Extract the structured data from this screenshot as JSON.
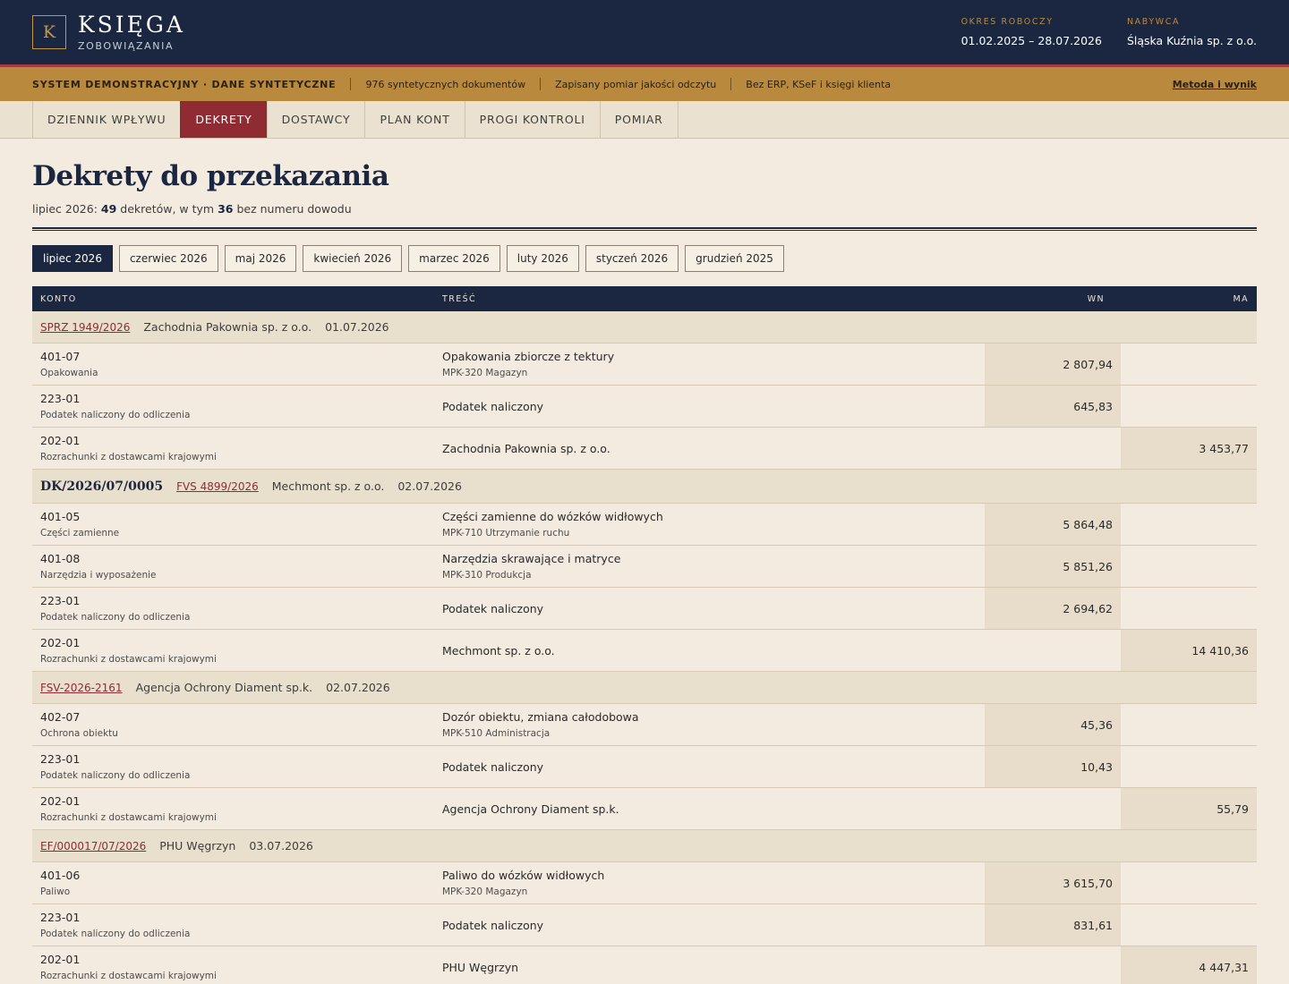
{
  "header": {
    "logo_letter": "K",
    "brand": "KSIĘGA",
    "brand_sub": "ZOBOWIĄZANIA",
    "period_label": "OKRES ROBOCZY",
    "period_value": "01.02.2025 – 28.07.2026",
    "buyer_label": "NABYWCA",
    "buyer_value": "Śląska Kuźnia sp. z o.o."
  },
  "notice": {
    "system": "SYSTEM DEMONSTRACYJNY · DANE SYNTETYCZNE",
    "docs": "976 syntetycznych dokumentów",
    "measure": "Zapisany pomiar jakości odczytu",
    "noerp": "Bez ERP, KSeF i księgi klienta",
    "link": "Metoda i wynik"
  },
  "nav": {
    "tabs": [
      "DZIENNIK WPŁYWU",
      "DEKRETY",
      "DOSTAWCY",
      "PLAN KONT",
      "PROGI KONTROLI",
      "POMIAR"
    ],
    "active": "DEKRETY"
  },
  "page": {
    "title": "Dekrety do przekazania",
    "sub_prefix": "lipiec 2026: ",
    "sub_count": "49",
    "sub_mid": " dekretów, w tym ",
    "sub_missing": "36",
    "sub_suffix": " bez numeru dowodu"
  },
  "months": [
    "lipiec 2026",
    "czerwiec 2026",
    "maj 2026",
    "kwiecień 2026",
    "marzec 2026",
    "luty 2026",
    "styczeń 2026",
    "grudzień 2025"
  ],
  "table": {
    "col_account": "KONTO",
    "col_desc": "TREŚĆ",
    "col_wn": "WN",
    "col_ma": "MA",
    "groups": [
      {
        "dk": "",
        "doc": "SPRZ 1949/2026",
        "vendor": "Zachodnia Pakownia sp. z o.o.",
        "date": "01.07.2026",
        "rows": [
          {
            "acc": "401-07",
            "acc_name": "Opakowania",
            "desc": "Opakowania zbiorcze z tektury",
            "mpk": "MPK-320 Magazyn",
            "wn": "2 807,94",
            "ma": ""
          },
          {
            "acc": "223-01",
            "acc_name": "Podatek naliczony do odliczenia",
            "desc": "Podatek naliczony",
            "mpk": "",
            "wn": "645,83",
            "ma": ""
          },
          {
            "acc": "202-01",
            "acc_name": "Rozrachunki z dostawcami krajowymi",
            "desc": "Zachodnia Pakownia sp. z o.o.",
            "mpk": "",
            "wn": "",
            "ma": "3 453,77"
          }
        ]
      },
      {
        "dk": "DK/2026/07/0005",
        "doc": "FVS 4899/2026",
        "vendor": "Mechmont sp. z o.o.",
        "date": "02.07.2026",
        "rows": [
          {
            "acc": "401-05",
            "acc_name": "Części zamienne",
            "desc": "Części zamienne do wózków widłowych",
            "mpk": "MPK-710 Utrzymanie ruchu",
            "wn": "5 864,48",
            "ma": ""
          },
          {
            "acc": "401-08",
            "acc_name": "Narzędzia i wyposażenie",
            "desc": "Narzędzia skrawające i matryce",
            "mpk": "MPK-310 Produkcja",
            "wn": "5 851,26",
            "ma": ""
          },
          {
            "acc": "223-01",
            "acc_name": "Podatek naliczony do odliczenia",
            "desc": "Podatek naliczony",
            "mpk": "",
            "wn": "2 694,62",
            "ma": ""
          },
          {
            "acc": "202-01",
            "acc_name": "Rozrachunki z dostawcami krajowymi",
            "desc": "Mechmont sp. z o.o.",
            "mpk": "",
            "wn": "",
            "ma": "14 410,36"
          }
        ]
      },
      {
        "dk": "",
        "doc": "FSV-2026-2161",
        "vendor": "Agencja Ochrony Diament sp.k.",
        "date": "02.07.2026",
        "rows": [
          {
            "acc": "402-07",
            "acc_name": "Ochrona obiektu",
            "desc": "Dozór obiektu, zmiana całodobowa",
            "mpk": "MPK-510 Administracja",
            "wn": "45,36",
            "ma": ""
          },
          {
            "acc": "223-01",
            "acc_name": "Podatek naliczony do odliczenia",
            "desc": "Podatek naliczony",
            "mpk": "",
            "wn": "10,43",
            "ma": ""
          },
          {
            "acc": "202-01",
            "acc_name": "Rozrachunki z dostawcami krajowymi",
            "desc": "Agencja Ochrony Diament sp.k.",
            "mpk": "",
            "wn": "",
            "ma": "55,79"
          }
        ]
      },
      {
        "dk": "",
        "doc": "EF/000017/07/2026",
        "vendor": "PHU Węgrzyn",
        "date": "03.07.2026",
        "rows": [
          {
            "acc": "401-06",
            "acc_name": "Paliwo",
            "desc": "Paliwo do wózków widłowych",
            "mpk": "MPK-320 Magazyn",
            "wn": "3 615,70",
            "ma": ""
          },
          {
            "acc": "223-01",
            "acc_name": "Podatek naliczony do odliczenia",
            "desc": "Podatek naliczony",
            "mpk": "",
            "wn": "831,61",
            "ma": ""
          },
          {
            "acc": "202-01",
            "acc_name": "Rozrachunki z dostawcami krajowymi",
            "desc": "PHU Węgrzyn",
            "mpk": "",
            "wn": "",
            "ma": "4 447,31"
          }
        ]
      }
    ]
  }
}
